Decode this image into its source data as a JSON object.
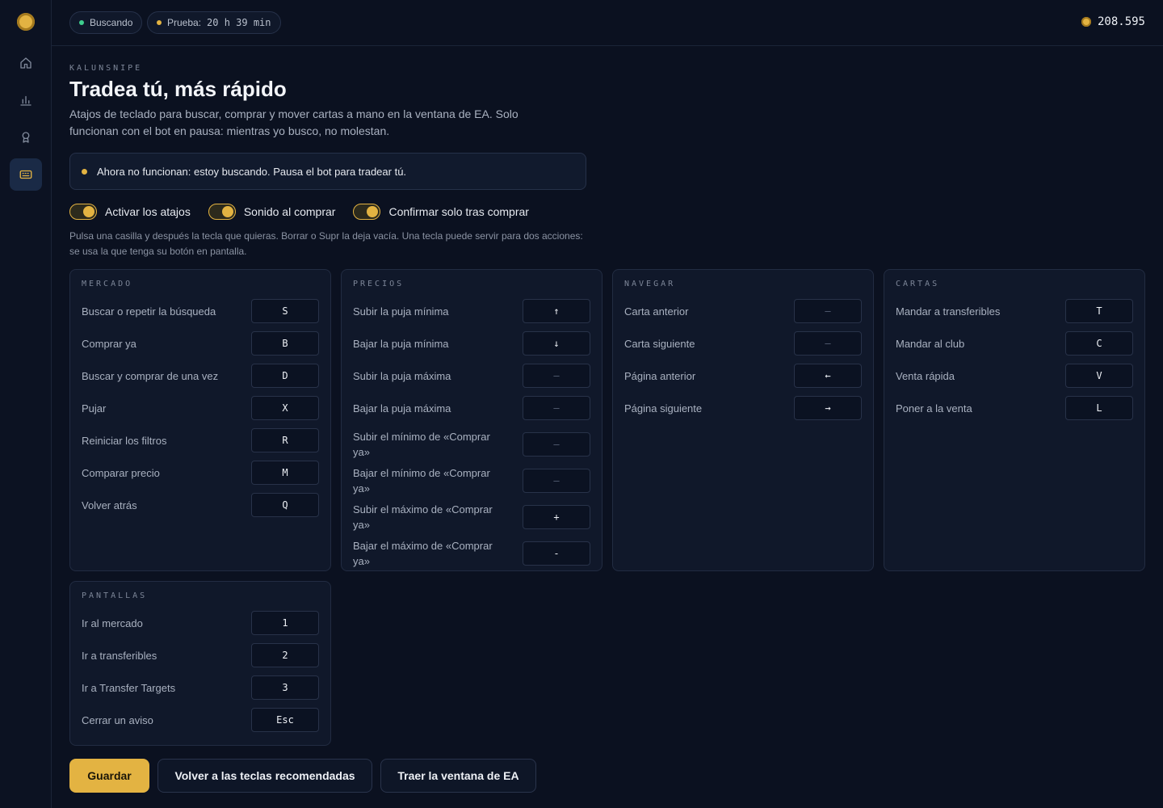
{
  "topbar": {
    "status_chip": "Buscando",
    "trial_label": "Prueba:",
    "trial_time": "20 h 39 min",
    "coins": "208.595",
    "status_color": "#3ecf8e",
    "trial_color": "#e3b342"
  },
  "sidebar": {
    "items": [
      "home-icon",
      "bar-chart-icon",
      "award-icon",
      "keyboard-icon"
    ]
  },
  "page": {
    "eyebrow": "KALUNSNIPE",
    "title": "Tradea tú, más rápido",
    "subtitle": "Atajos de teclado para buscar, comprar y mover cartas a mano en la ventana de EA. Solo funcionan con el bot en pausa: mientras yo busco, no molestan.",
    "notice": "Ahora no funcionan: estoy buscando. Pausa el bot para tradear tú.",
    "help": "Pulsa una casilla y después la tecla que quieras. Borrar o Supr la deja vacía. Una tecla puede servir para dos acciones: se usa la que tenga su botón en pantalla."
  },
  "toggles": [
    {
      "label": "Activar los atajos",
      "on": true
    },
    {
      "label": "Sonido al comprar",
      "on": true
    },
    {
      "label": "Confirmar solo tras comprar",
      "on": true
    }
  ],
  "panels": {
    "mercado": {
      "title": "MERCADO",
      "rows": [
        {
          "label": "Buscar o repetir la búsqueda",
          "key": "S"
        },
        {
          "label": "Comprar ya",
          "key": "B"
        },
        {
          "label": "Buscar y comprar de una vez",
          "key": "D"
        },
        {
          "label": "Pujar",
          "key": "X"
        },
        {
          "label": "Reiniciar los filtros",
          "key": "R"
        },
        {
          "label": "Comparar precio",
          "key": "M"
        },
        {
          "label": "Volver atrás",
          "key": "Q"
        }
      ]
    },
    "precios": {
      "title": "PRECIOS",
      "rows": [
        {
          "label": "Subir la puja mínima",
          "key": "↑"
        },
        {
          "label": "Bajar la puja mínima",
          "key": "↓"
        },
        {
          "label": "Subir la puja máxima",
          "key": "—"
        },
        {
          "label": "Bajar la puja máxima",
          "key": "—"
        },
        {
          "label": "Subir el mínimo de «Comprar ya»",
          "key": "—"
        },
        {
          "label": "Bajar el mínimo de «Comprar ya»",
          "key": "—"
        },
        {
          "label": "Subir el máximo de «Comprar ya»",
          "key": "+"
        },
        {
          "label": "Bajar el máximo de «Comprar ya»",
          "key": "-"
        }
      ]
    },
    "navegar": {
      "title": "NAVEGAR",
      "rows": [
        {
          "label": "Carta anterior",
          "key": "—"
        },
        {
          "label": "Carta siguiente",
          "key": "—"
        },
        {
          "label": "Página anterior",
          "key": "←"
        },
        {
          "label": "Página siguiente",
          "key": "→"
        }
      ]
    },
    "cartas": {
      "title": "CARTAS",
      "rows": [
        {
          "label": "Mandar a transferibles",
          "key": "T"
        },
        {
          "label": "Mandar al club",
          "key": "C"
        },
        {
          "label": "Venta rápida",
          "key": "V"
        },
        {
          "label": "Poner a la venta",
          "key": "L"
        }
      ]
    },
    "pantallas": {
      "title": "PANTALLAS",
      "rows": [
        {
          "label": "Ir al mercado",
          "key": "1"
        },
        {
          "label": "Ir a transferibles",
          "key": "2"
        },
        {
          "label": "Ir a Transfer Targets",
          "key": "3"
        },
        {
          "label": "Cerrar un aviso",
          "key": "Esc"
        }
      ]
    }
  },
  "actions": {
    "save": "Guardar",
    "reset": "Volver a las teclas recomendadas",
    "bring_window": "Traer la ventana de EA"
  },
  "colors": {
    "accent": "#e3b342",
    "background": "#0b1120",
    "panel": "#10182a"
  }
}
